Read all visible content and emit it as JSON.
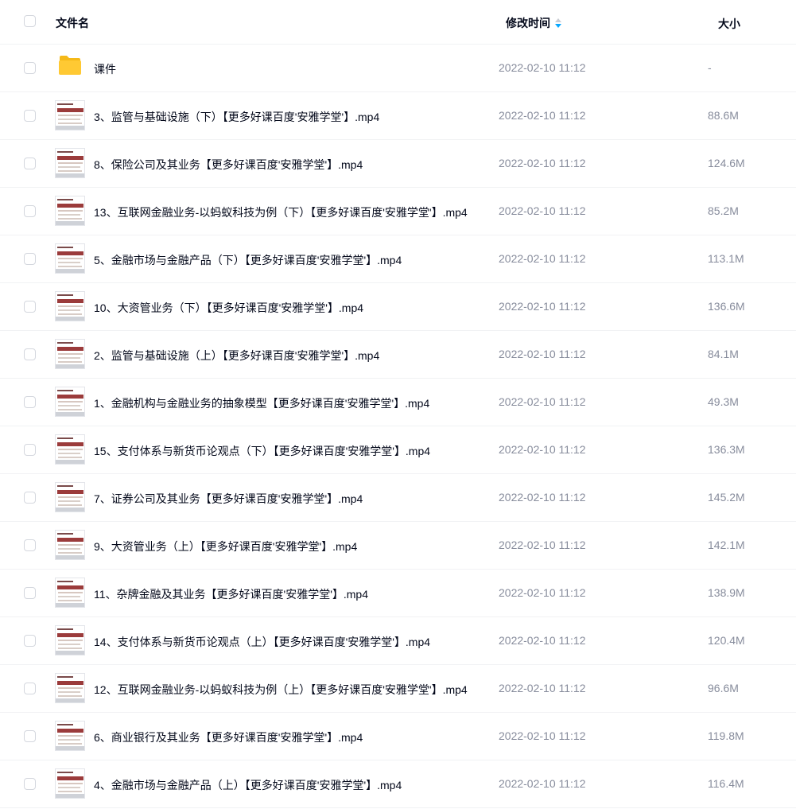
{
  "header": {
    "name_label": "文件名",
    "time_label": "修改时间",
    "size_label": "大小"
  },
  "rows": [
    {
      "name": "课件",
      "time": "2022-02-10 11:12",
      "size": "-",
      "type": "folder"
    },
    {
      "name": "3、监管与基础设施（下）【更多好课百度'安雅学堂'】.mp4",
      "time": "2022-02-10 11:12",
      "size": "88.6M",
      "type": "video"
    },
    {
      "name": "8、保险公司及其业务【更多好课百度'安雅学堂'】.mp4",
      "time": "2022-02-10 11:12",
      "size": "124.6M",
      "type": "video"
    },
    {
      "name": "13、互联网金融业务-以蚂蚁科技为例（下）【更多好课百度'安雅学堂'】.mp4",
      "time": "2022-02-10 11:12",
      "size": "85.2M",
      "type": "video"
    },
    {
      "name": "5、金融市场与金融产品（下）【更多好课百度'安雅学堂'】.mp4",
      "time": "2022-02-10 11:12",
      "size": "113.1M",
      "type": "video"
    },
    {
      "name": "10、大资管业务（下）【更多好课百度'安雅学堂'】.mp4",
      "time": "2022-02-10 11:12",
      "size": "136.6M",
      "type": "video"
    },
    {
      "name": "2、监管与基础设施（上）【更多好课百度'安雅学堂'】.mp4",
      "time": "2022-02-10 11:12",
      "size": "84.1M",
      "type": "video"
    },
    {
      "name": "1、金融机构与金融业务的抽象模型【更多好课百度'安雅学堂'】.mp4",
      "time": "2022-02-10 11:12",
      "size": "49.3M",
      "type": "video"
    },
    {
      "name": "15、支付体系与新货币论观点（下）【更多好课百度'安雅学堂'】.mp4",
      "time": "2022-02-10 11:12",
      "size": "136.3M",
      "type": "video"
    },
    {
      "name": "7、证券公司及其业务【更多好课百度'安雅学堂'】.mp4",
      "time": "2022-02-10 11:12",
      "size": "145.2M",
      "type": "video"
    },
    {
      "name": "9、大资管业务（上）【更多好课百度'安雅学堂'】.mp4",
      "time": "2022-02-10 11:12",
      "size": "142.1M",
      "type": "video"
    },
    {
      "name": "11、杂牌金融及其业务【更多好课百度'安雅学堂'】.mp4",
      "time": "2022-02-10 11:12",
      "size": "138.9M",
      "type": "video"
    },
    {
      "name": "14、支付体系与新货币论观点（上）【更多好课百度'安雅学堂'】.mp4",
      "time": "2022-02-10 11:12",
      "size": "120.4M",
      "type": "video"
    },
    {
      "name": "12、互联网金融业务-以蚂蚁科技为例（上）【更多好课百度'安雅学堂'】.mp4",
      "time": "2022-02-10 11:12",
      "size": "96.6M",
      "type": "video"
    },
    {
      "name": "6、商业银行及其业务【更多好课百度'安雅学堂'】.mp4",
      "time": "2022-02-10 11:12",
      "size": "119.8M",
      "type": "video"
    },
    {
      "name": "4、金融市场与金融产品（上）【更多好课百度'安雅学堂'】.mp4",
      "time": "2022-02-10 11:12",
      "size": "116.4M",
      "type": "video"
    }
  ],
  "colors": {
    "accent": "#06a7ff",
    "folder": "#ffc933",
    "muted_text": "#878c9c"
  }
}
